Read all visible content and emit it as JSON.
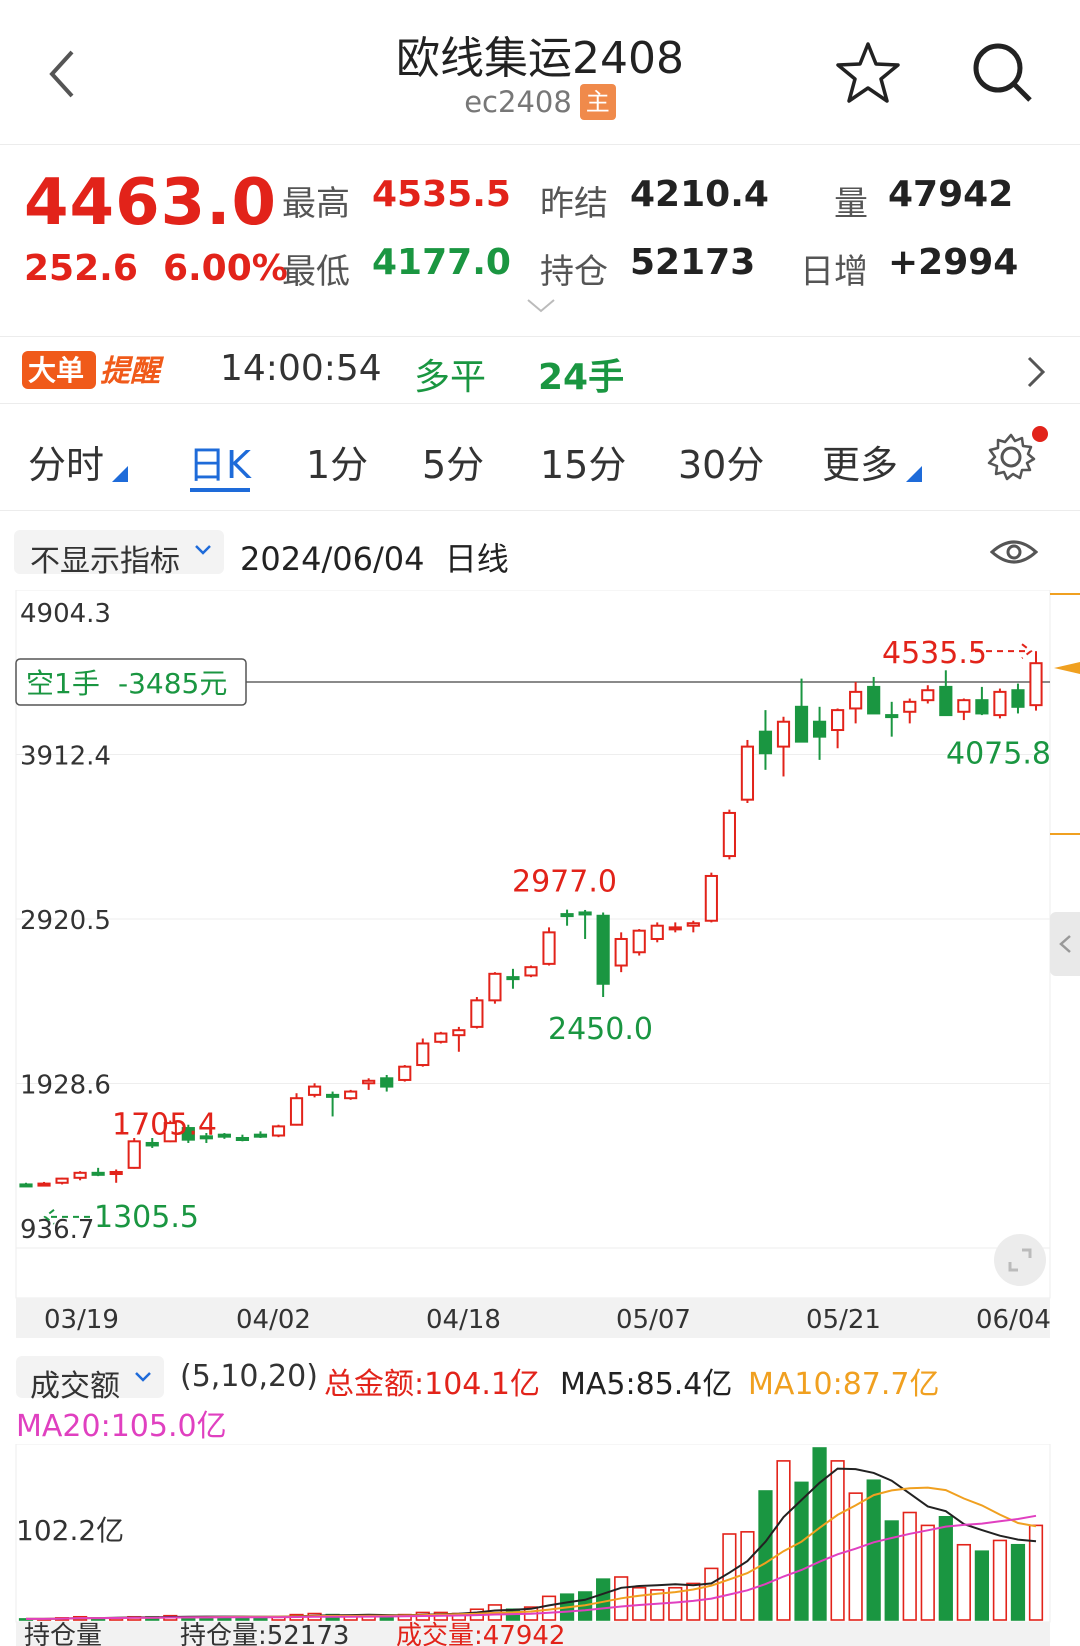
{
  "header": {
    "title": "欧线集运2408",
    "code": "ec2408",
    "badge": "主"
  },
  "quote": {
    "price": "4463.0",
    "change": "252.6",
    "change_pct": "6.00%",
    "high_label": "最高",
    "high": "4535.5",
    "low_label": "最低",
    "low": "4177.0",
    "prev_settle_label": "昨结",
    "prev_settle": "4210.4",
    "open_interest_label": "持仓",
    "open_interest": "52173",
    "volume_label": "量",
    "volume": "47942",
    "daily_change_label": "日增",
    "daily_change": "+2994"
  },
  "big_order": {
    "logo_text_1": "大单",
    "logo_text_2": "提醒",
    "time": "14:00:54",
    "type": "多平",
    "qty": "24手"
  },
  "tabs": [
    {
      "label": "分时"
    },
    {
      "label": "日K",
      "active": true
    },
    {
      "label": "1分"
    },
    {
      "label": "5分"
    },
    {
      "label": "15分"
    },
    {
      "label": "30分"
    },
    {
      "label": "更多"
    }
  ],
  "chart_header": {
    "indicator_select": "不显示指标",
    "date": "2024/06/04",
    "period": "日线"
  },
  "position_tag": {
    "side": "空1手",
    "pnl": "-3485元"
  },
  "colors": {
    "up": "#e2231a",
    "down": "#1a9641",
    "accent": "#1e6bd9",
    "ma5": "#222222",
    "ma10": "#f0a020",
    "ma20": "#e040c0"
  },
  "chart_data": {
    "type": "candlestick",
    "y_ticks": [
      "4904.3",
      "3912.4",
      "2920.5",
      "1928.6",
      "936.7"
    ],
    "ylim": [
      936.7,
      4904.3
    ],
    "x_ticks": [
      "03/19",
      "04/02",
      "04/18",
      "05/07",
      "05/21",
      "06/04"
    ],
    "annotations": {
      "max_label": "4535.5",
      "max_recent_low": "4075.8",
      "peak_label": "2977.0",
      "trough_label": "2450.0",
      "mid_label": "1705.4",
      "min_label": "1305.5"
    },
    "candles": [
      {
        "o": 1320,
        "h": 1330,
        "l": 1305,
        "c": 1315
      },
      {
        "o": 1318,
        "h": 1335,
        "l": 1308,
        "c": 1325
      },
      {
        "o": 1330,
        "h": 1360,
        "l": 1320,
        "c": 1355
      },
      {
        "o": 1360,
        "h": 1400,
        "l": 1345,
        "c": 1390
      },
      {
        "o": 1390,
        "h": 1420,
        "l": 1370,
        "c": 1380
      },
      {
        "o": 1385,
        "h": 1410,
        "l": 1330,
        "c": 1395
      },
      {
        "o": 1420,
        "h": 1600,
        "l": 1415,
        "c": 1580
      },
      {
        "o": 1570,
        "h": 1600,
        "l": 1540,
        "c": 1555
      },
      {
        "o": 1580,
        "h": 1705,
        "l": 1575,
        "c": 1690
      },
      {
        "o": 1660,
        "h": 1680,
        "l": 1570,
        "c": 1590
      },
      {
        "o": 1610,
        "h": 1630,
        "l": 1570,
        "c": 1605
      },
      {
        "o": 1620,
        "h": 1630,
        "l": 1595,
        "c": 1610
      },
      {
        "o": 1600,
        "h": 1620,
        "l": 1580,
        "c": 1598
      },
      {
        "o": 1620,
        "h": 1640,
        "l": 1600,
        "c": 1615
      },
      {
        "o": 1615,
        "h": 1680,
        "l": 1605,
        "c": 1670
      },
      {
        "o": 1680,
        "h": 1870,
        "l": 1675,
        "c": 1840
      },
      {
        "o": 1860,
        "h": 1930,
        "l": 1845,
        "c": 1910
      },
      {
        "o": 1860,
        "h": 1880,
        "l": 1730,
        "c": 1850
      },
      {
        "o": 1840,
        "h": 1890,
        "l": 1830,
        "c": 1880
      },
      {
        "o": 1930,
        "h": 1960,
        "l": 1890,
        "c": 1945
      },
      {
        "o": 1960,
        "h": 1980,
        "l": 1880,
        "c": 1910
      },
      {
        "o": 1950,
        "h": 2040,
        "l": 1940,
        "c": 2030
      },
      {
        "o": 2040,
        "h": 2200,
        "l": 2030,
        "c": 2170
      },
      {
        "o": 2180,
        "h": 2240,
        "l": 2170,
        "c": 2230
      },
      {
        "o": 2220,
        "h": 2270,
        "l": 2120,
        "c": 2250
      },
      {
        "o": 2270,
        "h": 2450,
        "l": 2260,
        "c": 2430
      },
      {
        "o": 2430,
        "h": 2600,
        "l": 2410,
        "c": 2590
      },
      {
        "o": 2570,
        "h": 2620,
        "l": 2500,
        "c": 2560
      },
      {
        "o": 2580,
        "h": 2640,
        "l": 2570,
        "c": 2630
      },
      {
        "o": 2650,
        "h": 2870,
        "l": 2640,
        "c": 2840
      },
      {
        "o": 2950,
        "h": 2977,
        "l": 2880,
        "c": 2940
      },
      {
        "o": 2960,
        "h": 2975,
        "l": 2800,
        "c": 2950
      },
      {
        "o": 2940,
        "h": 2960,
        "l": 2450,
        "c": 2530
      },
      {
        "o": 2640,
        "h": 2840,
        "l": 2600,
        "c": 2800
      },
      {
        "o": 2720,
        "h": 2860,
        "l": 2700,
        "c": 2850
      },
      {
        "o": 2800,
        "h": 2900,
        "l": 2780,
        "c": 2880
      },
      {
        "o": 2860,
        "h": 2900,
        "l": 2840,
        "c": 2870
      },
      {
        "o": 2880,
        "h": 2910,
        "l": 2840,
        "c": 2895
      },
      {
        "o": 2910,
        "h": 3200,
        "l": 2900,
        "c": 3180
      },
      {
        "o": 3300,
        "h": 3580,
        "l": 3280,
        "c": 3560
      },
      {
        "o": 3640,
        "h": 4000,
        "l": 3620,
        "c": 3960
      },
      {
        "o": 4050,
        "h": 4180,
        "l": 3820,
        "c": 3920
      },
      {
        "o": 3960,
        "h": 4140,
        "l": 3780,
        "c": 4110
      },
      {
        "o": 4200,
        "h": 4370,
        "l": 4040,
        "c": 3990
      },
      {
        "o": 4110,
        "h": 4200,
        "l": 3880,
        "c": 4020
      },
      {
        "o": 4060,
        "h": 4190,
        "l": 3950,
        "c": 4180
      },
      {
        "o": 4190,
        "h": 4350,
        "l": 4100,
        "c": 4290
      },
      {
        "o": 4320,
        "h": 4380,
        "l": 4170,
        "c": 4160
      },
      {
        "o": 4150,
        "h": 4230,
        "l": 4020,
        "c": 4140
      },
      {
        "o": 4170,
        "h": 4250,
        "l": 4100,
        "c": 4230
      },
      {
        "o": 4240,
        "h": 4330,
        "l": 4220,
        "c": 4300
      },
      {
        "o": 4320,
        "h": 4420,
        "l": 4300,
        "c": 4150
      },
      {
        "o": 4170,
        "h": 4250,
        "l": 4120,
        "c": 4240
      },
      {
        "o": 4240,
        "h": 4320,
        "l": 4150,
        "c": 4160
      },
      {
        "o": 4150,
        "h": 4310,
        "l": 4130,
        "c": 4290
      },
      {
        "o": 4300,
        "h": 4340,
        "l": 4160,
        "c": 4200
      },
      {
        "o": 4210,
        "h": 4535.5,
        "l": 4177,
        "c": 4463
      }
    ]
  },
  "volume": {
    "select_label": "成交额",
    "params": "(5,10,20)",
    "total": "总金额:104.1亿",
    "ma5": "MA5:85.4亿",
    "ma10": "MA10:87.7亿",
    "ma20": "MA20:105.0亿",
    "y_label": "102.2亿",
    "bars": [
      1,
      1,
      2,
      3,
      2,
      2,
      3,
      3,
      4,
      3,
      3,
      3,
      3,
      3,
      3,
      5,
      6,
      5,
      4,
      4,
      4,
      5,
      7,
      7,
      6,
      10,
      14,
      10,
      12,
      22,
      24,
      26,
      38,
      40,
      30,
      28,
      30,
      34,
      48,
      80,
      82,
      120,
      148,
      128,
      160,
      148,
      118,
      130,
      92,
      100,
      88,
      96,
      70,
      64,
      74,
      70,
      88
    ],
    "footer_left": "持仓量",
    "footer_oi": "持仓量:52173",
    "footer_vol": "成交量:47942"
  }
}
